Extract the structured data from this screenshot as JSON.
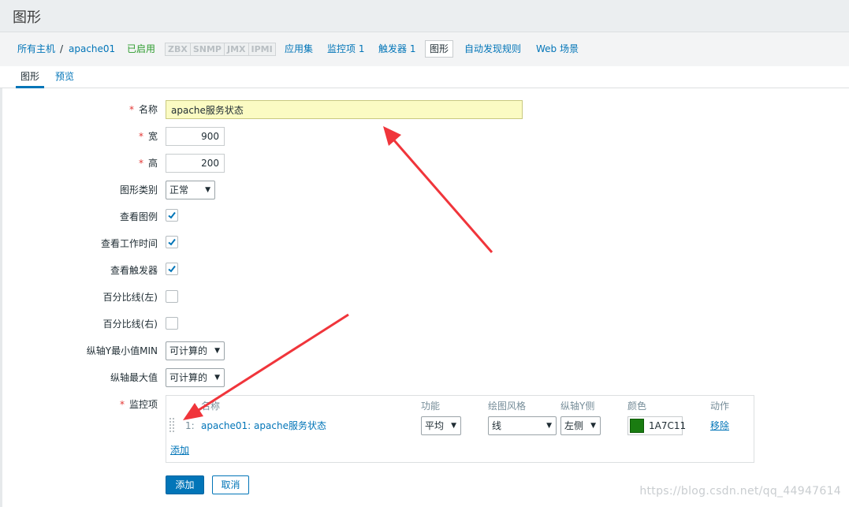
{
  "page": {
    "title": "图形"
  },
  "breadcrumb": {
    "all_hosts": "所有主机",
    "separator": "/",
    "host": "apache01",
    "status": "已启用"
  },
  "availability": [
    "ZBX",
    "SNMP",
    "JMX",
    "IPMI"
  ],
  "nav": {
    "applications": "应用集",
    "items": "监控项 1",
    "triggers": "触发器 1",
    "graphs": "图形",
    "discovery": "自动发现规则",
    "web": "Web 场景"
  },
  "tabs": {
    "graph": "图形",
    "preview": "预览"
  },
  "form": {
    "name": {
      "label": "名称",
      "value": "apache服务状态"
    },
    "width": {
      "label": "宽",
      "value": "900"
    },
    "height": {
      "label": "高",
      "value": "200"
    },
    "graph_type": {
      "label": "图形类别",
      "value": "正常"
    },
    "show_legend": {
      "label": "查看图例",
      "checked": true
    },
    "show_working_time": {
      "label": "查看工作时间",
      "checked": true
    },
    "show_triggers": {
      "label": "查看触发器",
      "checked": true
    },
    "percentile_left": {
      "label": "百分比线(左)",
      "checked": false
    },
    "percentile_right": {
      "label": "百分比线(右)",
      "checked": false
    },
    "y_min": {
      "label": "纵轴Y最小值MIN",
      "value": "可计算的"
    },
    "y_max": {
      "label": "纵轴最大值",
      "value": "可计算的"
    },
    "items_label": "监控项"
  },
  "items_table": {
    "headers": {
      "name": "名称",
      "function": "功能",
      "draw_style": "绘图风格",
      "y_axis_side": "纵轴Y侧",
      "color": "颜色",
      "action": "动作"
    },
    "rows": [
      {
        "index": "1:",
        "name": "apache01: apache服务状态",
        "function": "平均",
        "draw_style": "线",
        "y_axis_side": "左侧",
        "color": "1A7C11",
        "remove": "移除"
      }
    ],
    "add_link": "添加"
  },
  "buttons": {
    "add": "添加",
    "cancel": "取消"
  },
  "watermark": "https://blog.csdn.net/qq_44947614",
  "colors": {
    "link": "#0275b8",
    "enabled": "#2e9c2e",
    "required": "#e33734",
    "annotation_arrow": "#f0353b",
    "swatch": "#1a7c11"
  }
}
